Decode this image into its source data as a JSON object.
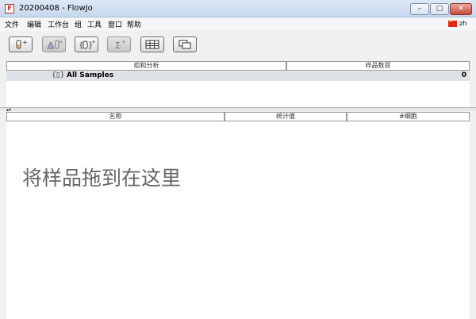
{
  "window": {
    "title": "20200408 - FlowJo",
    "app_icon": "flowjo-icon"
  },
  "menubar": {
    "items": [
      "文件",
      "编辑",
      "工作台",
      "组",
      "工具",
      "窗口",
      "帮助"
    ],
    "lang_code": "zh"
  },
  "toolbar": {
    "buttons": [
      {
        "icon": "add-tube-icon"
      },
      {
        "icon": "tube-analysis-icon"
      },
      {
        "icon": "add-group-icon"
      },
      {
        "icon": "add-statistic-icon"
      },
      {
        "icon": "table-icon"
      },
      {
        "icon": "layout-icon"
      }
    ]
  },
  "groups": {
    "col_name": "组和分析",
    "col_count": "样品数目",
    "rows": [
      {
        "name": "All Samples",
        "count": "0"
      }
    ]
  },
  "samples": {
    "col_name": "名称",
    "col_stat": "统计值",
    "col_cells": "#细胞",
    "drop_hint": "将样品拖到在这里"
  }
}
